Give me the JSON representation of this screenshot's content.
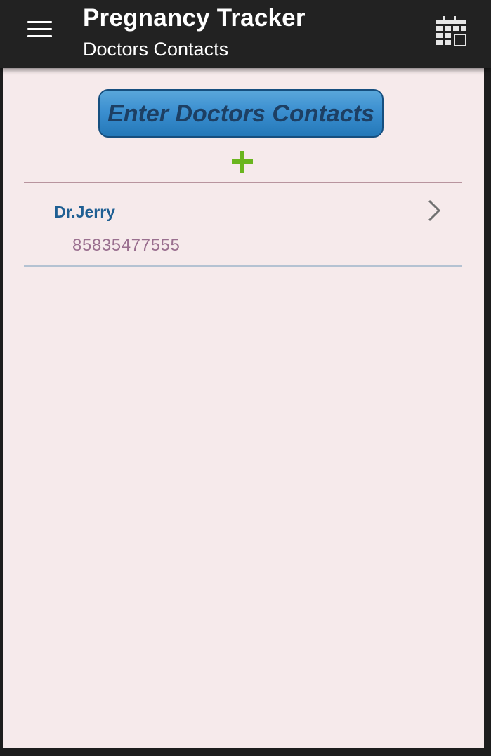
{
  "app_bar": {
    "title": "Pregnancy Tracker",
    "subtitle": "Doctors Contacts",
    "menu_icon": "hamburger-menu-icon",
    "calendar_icon": "calendar-icon"
  },
  "main": {
    "enter_button_label": "Enter Doctors Contacts",
    "add_icon": "plus-icon",
    "contacts": [
      {
        "name": "Dr.Jerry",
        "phone": "85835477555"
      }
    ]
  },
  "colors": {
    "app_bar_bg": "#222222",
    "content_bg": "#f6eaeb",
    "button_blue": "#3b8fd0",
    "add_green": "#6ab51e",
    "name_blue": "#1f5f93",
    "phone_mauve": "#9a6f8f"
  }
}
